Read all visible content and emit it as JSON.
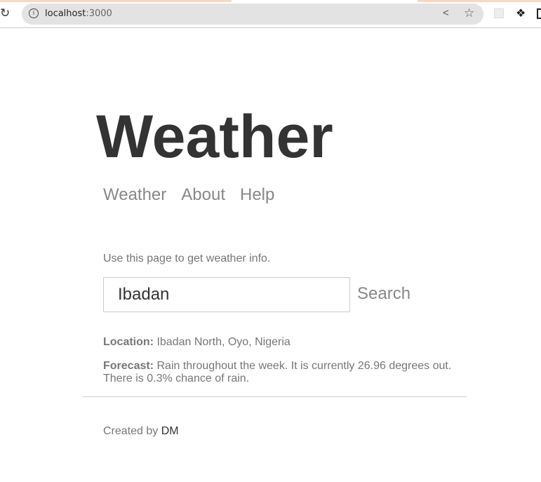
{
  "browser": {
    "url_host": "localhost",
    "url_port": ":3000"
  },
  "page": {
    "title": "Weather",
    "nav": [
      "Weather",
      "About",
      "Help"
    ],
    "intro": "Use this page to get weather info.",
    "search": {
      "value": "Ibadan",
      "button": "Search"
    },
    "location_label": "Location:",
    "location": "Ibadan North, Oyo, Nigeria",
    "forecast_label": "Forecast:",
    "forecast": "Rain throughout the week. It is currently 26.96 degrees out. There is 0.3% chance of rain.",
    "footer_text": "Created by ",
    "footer_author": "DM"
  }
}
